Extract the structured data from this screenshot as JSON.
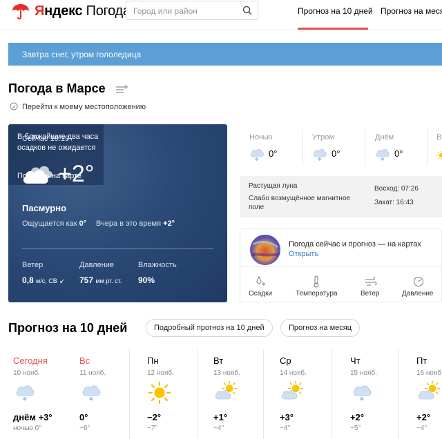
{
  "header": {
    "brand_y": "Я",
    "brand_rest": "ндекс",
    "brand_pogoda": "Погода",
    "search_placeholder": "Город или район",
    "nav": [
      "Прогноз на 10 дней",
      "Прогноз на месяц"
    ],
    "accent": "#e85050"
  },
  "banner": {
    "text": "Завтра снег, утром гололедица",
    "color": "#5b9fd6"
  },
  "place": {
    "title": "Погода в Марсе",
    "locate_link": "Перейти к моему местоположению"
  },
  "current": {
    "time_label": "Сейчас 19:19",
    "icon": "cloudy-icon",
    "temp": "+2°",
    "condition": "Пасмурно",
    "feels_label": "Ощущается как",
    "feels_value": "0°",
    "yesterday_label": "Вчера в это время",
    "yesterday_value": "+2°",
    "precip_text": "В ближайшие два часа осадков не ожидается",
    "map_link": "Показать на карте",
    "wind_label": "Ветер",
    "wind_value": "0,8",
    "wind_unit": "м/с, СВ",
    "pressure_label": "Давление",
    "pressure_value": "757",
    "pressure_unit": "мм рт. ст.",
    "humidity_label": "Влажность",
    "humidity_value": "90%"
  },
  "day_parts": [
    {
      "label": "Ночью",
      "temp": "0°",
      "icon": "snow-cloud-icon"
    },
    {
      "label": "Утром",
      "temp": "0°",
      "icon": "snow-cloud-icon"
    },
    {
      "label": "Днём",
      "temp": "0°",
      "icon": "snow-cloud-icon"
    },
    {
      "label": "В",
      "temp": "",
      "icon": "sun-cloud-icon"
    }
  ],
  "astro": {
    "moon": "Растущая луна",
    "magnetic": "Слабо возмущённое магнитное поле",
    "sunrise": "Восход: 07:26",
    "sunset": "Закат: 16:43"
  },
  "maps": {
    "title": "Погода сейчас и прогноз — на картах",
    "open": "Открыть",
    "links": [
      {
        "label": "Осадки",
        "icon": "precipitation-icon"
      },
      {
        "label": "Температура",
        "icon": "thermometer-icon"
      },
      {
        "label": "Ветер",
        "icon": "wind-icon"
      },
      {
        "label": "Давление",
        "icon": "pressure-gauge-icon"
      }
    ]
  },
  "forecast": {
    "title": "Прогноз на 10 дней",
    "detail_button": "Подробный прогноз на 10 дней",
    "month_button": "Прогноз на месяц",
    "days": [
      {
        "day": "Сегодня",
        "date": "10 нояб.",
        "icon": "snow-cloud-icon",
        "high": "днём +3°",
        "low": "ночью 0°",
        "weekend": true
      },
      {
        "day": "Вс",
        "date": "11 нояб.",
        "icon": "snow-cloud-icon",
        "high": "0°",
        "low": "−6°",
        "weekend": true
      },
      {
        "day": "Пн",
        "date": "12 нояб.",
        "icon": "sun-icon",
        "high": "−2°",
        "low": "−7°",
        "weekend": false
      },
      {
        "day": "Вт",
        "date": "13 нояб.",
        "icon": "sun-cloud-icon",
        "high": "+1°",
        "low": "−4°",
        "weekend": false
      },
      {
        "day": "Ср",
        "date": "14 нояб.",
        "icon": "sun-cloud-icon",
        "high": "+3°",
        "low": "−4°",
        "weekend": false
      },
      {
        "day": "Чт",
        "date": "15 нояб.",
        "icon": "snow-cloud-icon",
        "high": "+2°",
        "low": "−5°",
        "weekend": false
      },
      {
        "day": "Пт",
        "date": "16 нояб.",
        "icon": "sun-cloud-icon",
        "high": "+2°",
        "low": "−4°",
        "weekend": false
      }
    ]
  }
}
